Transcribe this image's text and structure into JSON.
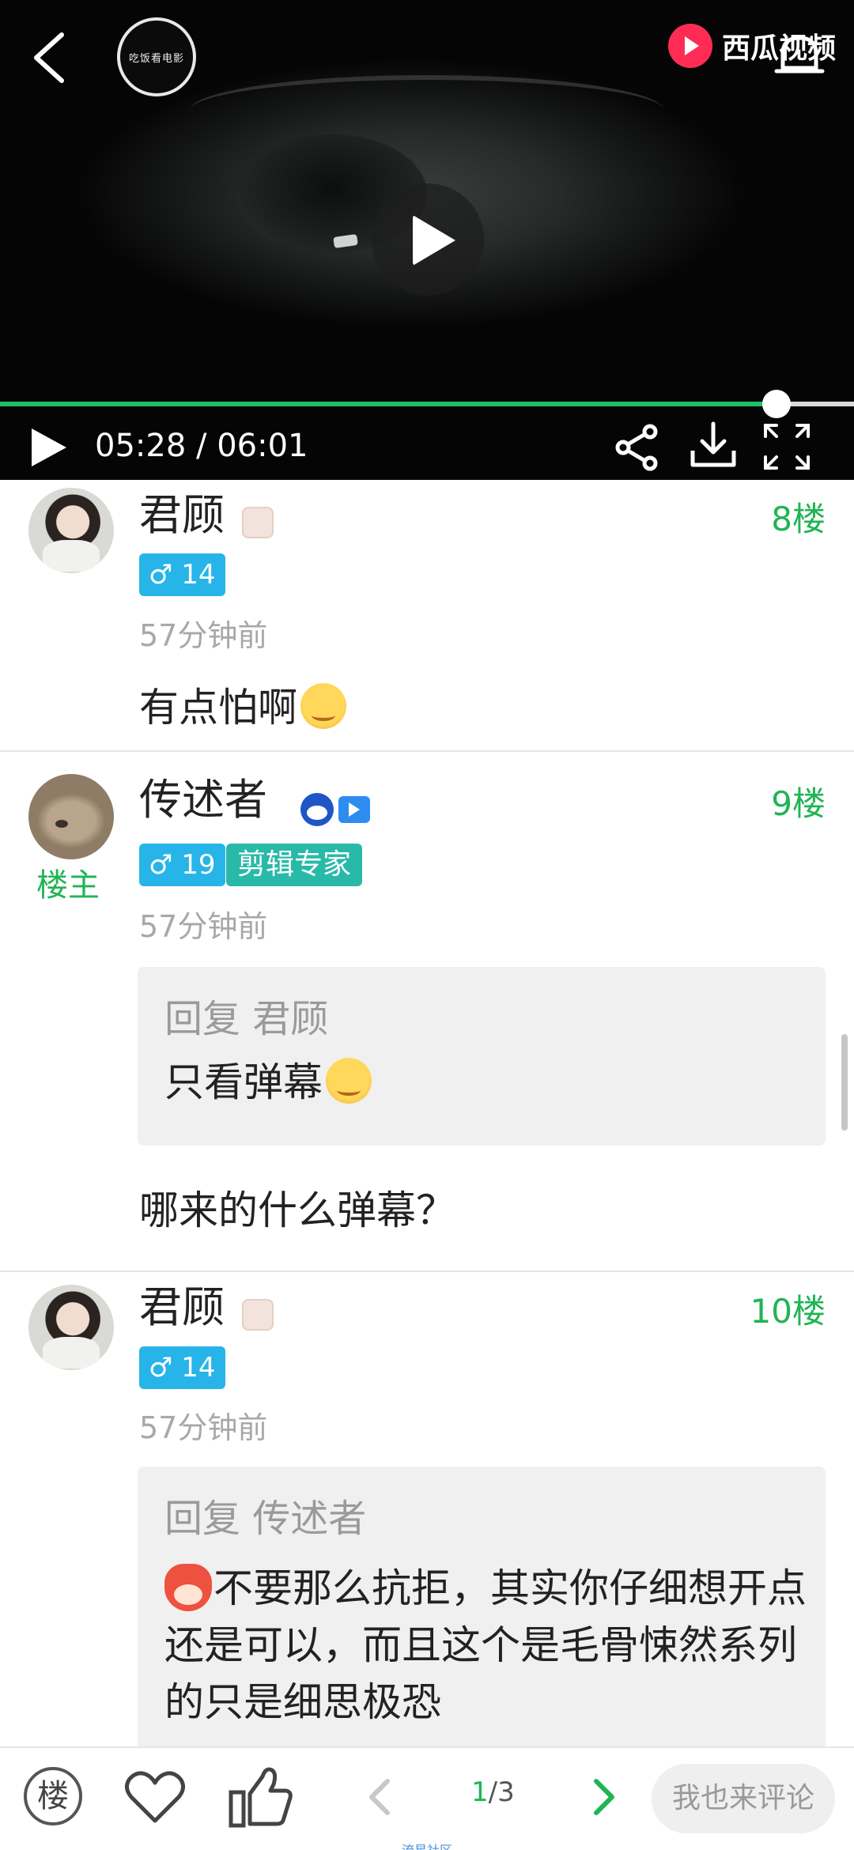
{
  "player": {
    "channel_logo": "吃饭看电影",
    "brand": "西瓜视频",
    "current_time": "05:28",
    "duration": "06:01",
    "progress": 0.909,
    "icons": [
      "back-arrow-icon",
      "settings-icon",
      "play-icon",
      "share-icon",
      "download-icon",
      "fullscreen-icon"
    ]
  },
  "comments": [
    {
      "user": "君顾",
      "gender_level": "♂ 14",
      "floor": "8楼",
      "time": "57分钟前",
      "text": "有点怕啊"
    },
    {
      "user": "传述者",
      "owner_tag": "楼主",
      "gender_level": "♂ 19",
      "title_tag": "剪辑专家",
      "floor": "9楼",
      "time": "57分钟前",
      "quote_reply": "回复 君顾",
      "quote_text": "只看弹幕",
      "text": "哪来的什么弹幕？"
    },
    {
      "user": "君顾",
      "gender_level": "♂ 14",
      "floor": "10楼",
      "time": "57分钟前",
      "quote_reply": "回复 传述者",
      "quote_text": "不要那么抗拒，其实你仔细想开点还是可以，而且这个是毛骨悚然系列的只是细思极恐"
    }
  ],
  "bottom_bar": {
    "floor_button": "楼",
    "page_current": "1",
    "page_total": "/3",
    "comment_placeholder": "我也来评论",
    "footer_mark": "流星社区"
  },
  "colors": {
    "accent": "#20b454",
    "level_badge": "#27b4e8",
    "title_badge": "#29b9a9",
    "brand": "#fe2c55"
  }
}
